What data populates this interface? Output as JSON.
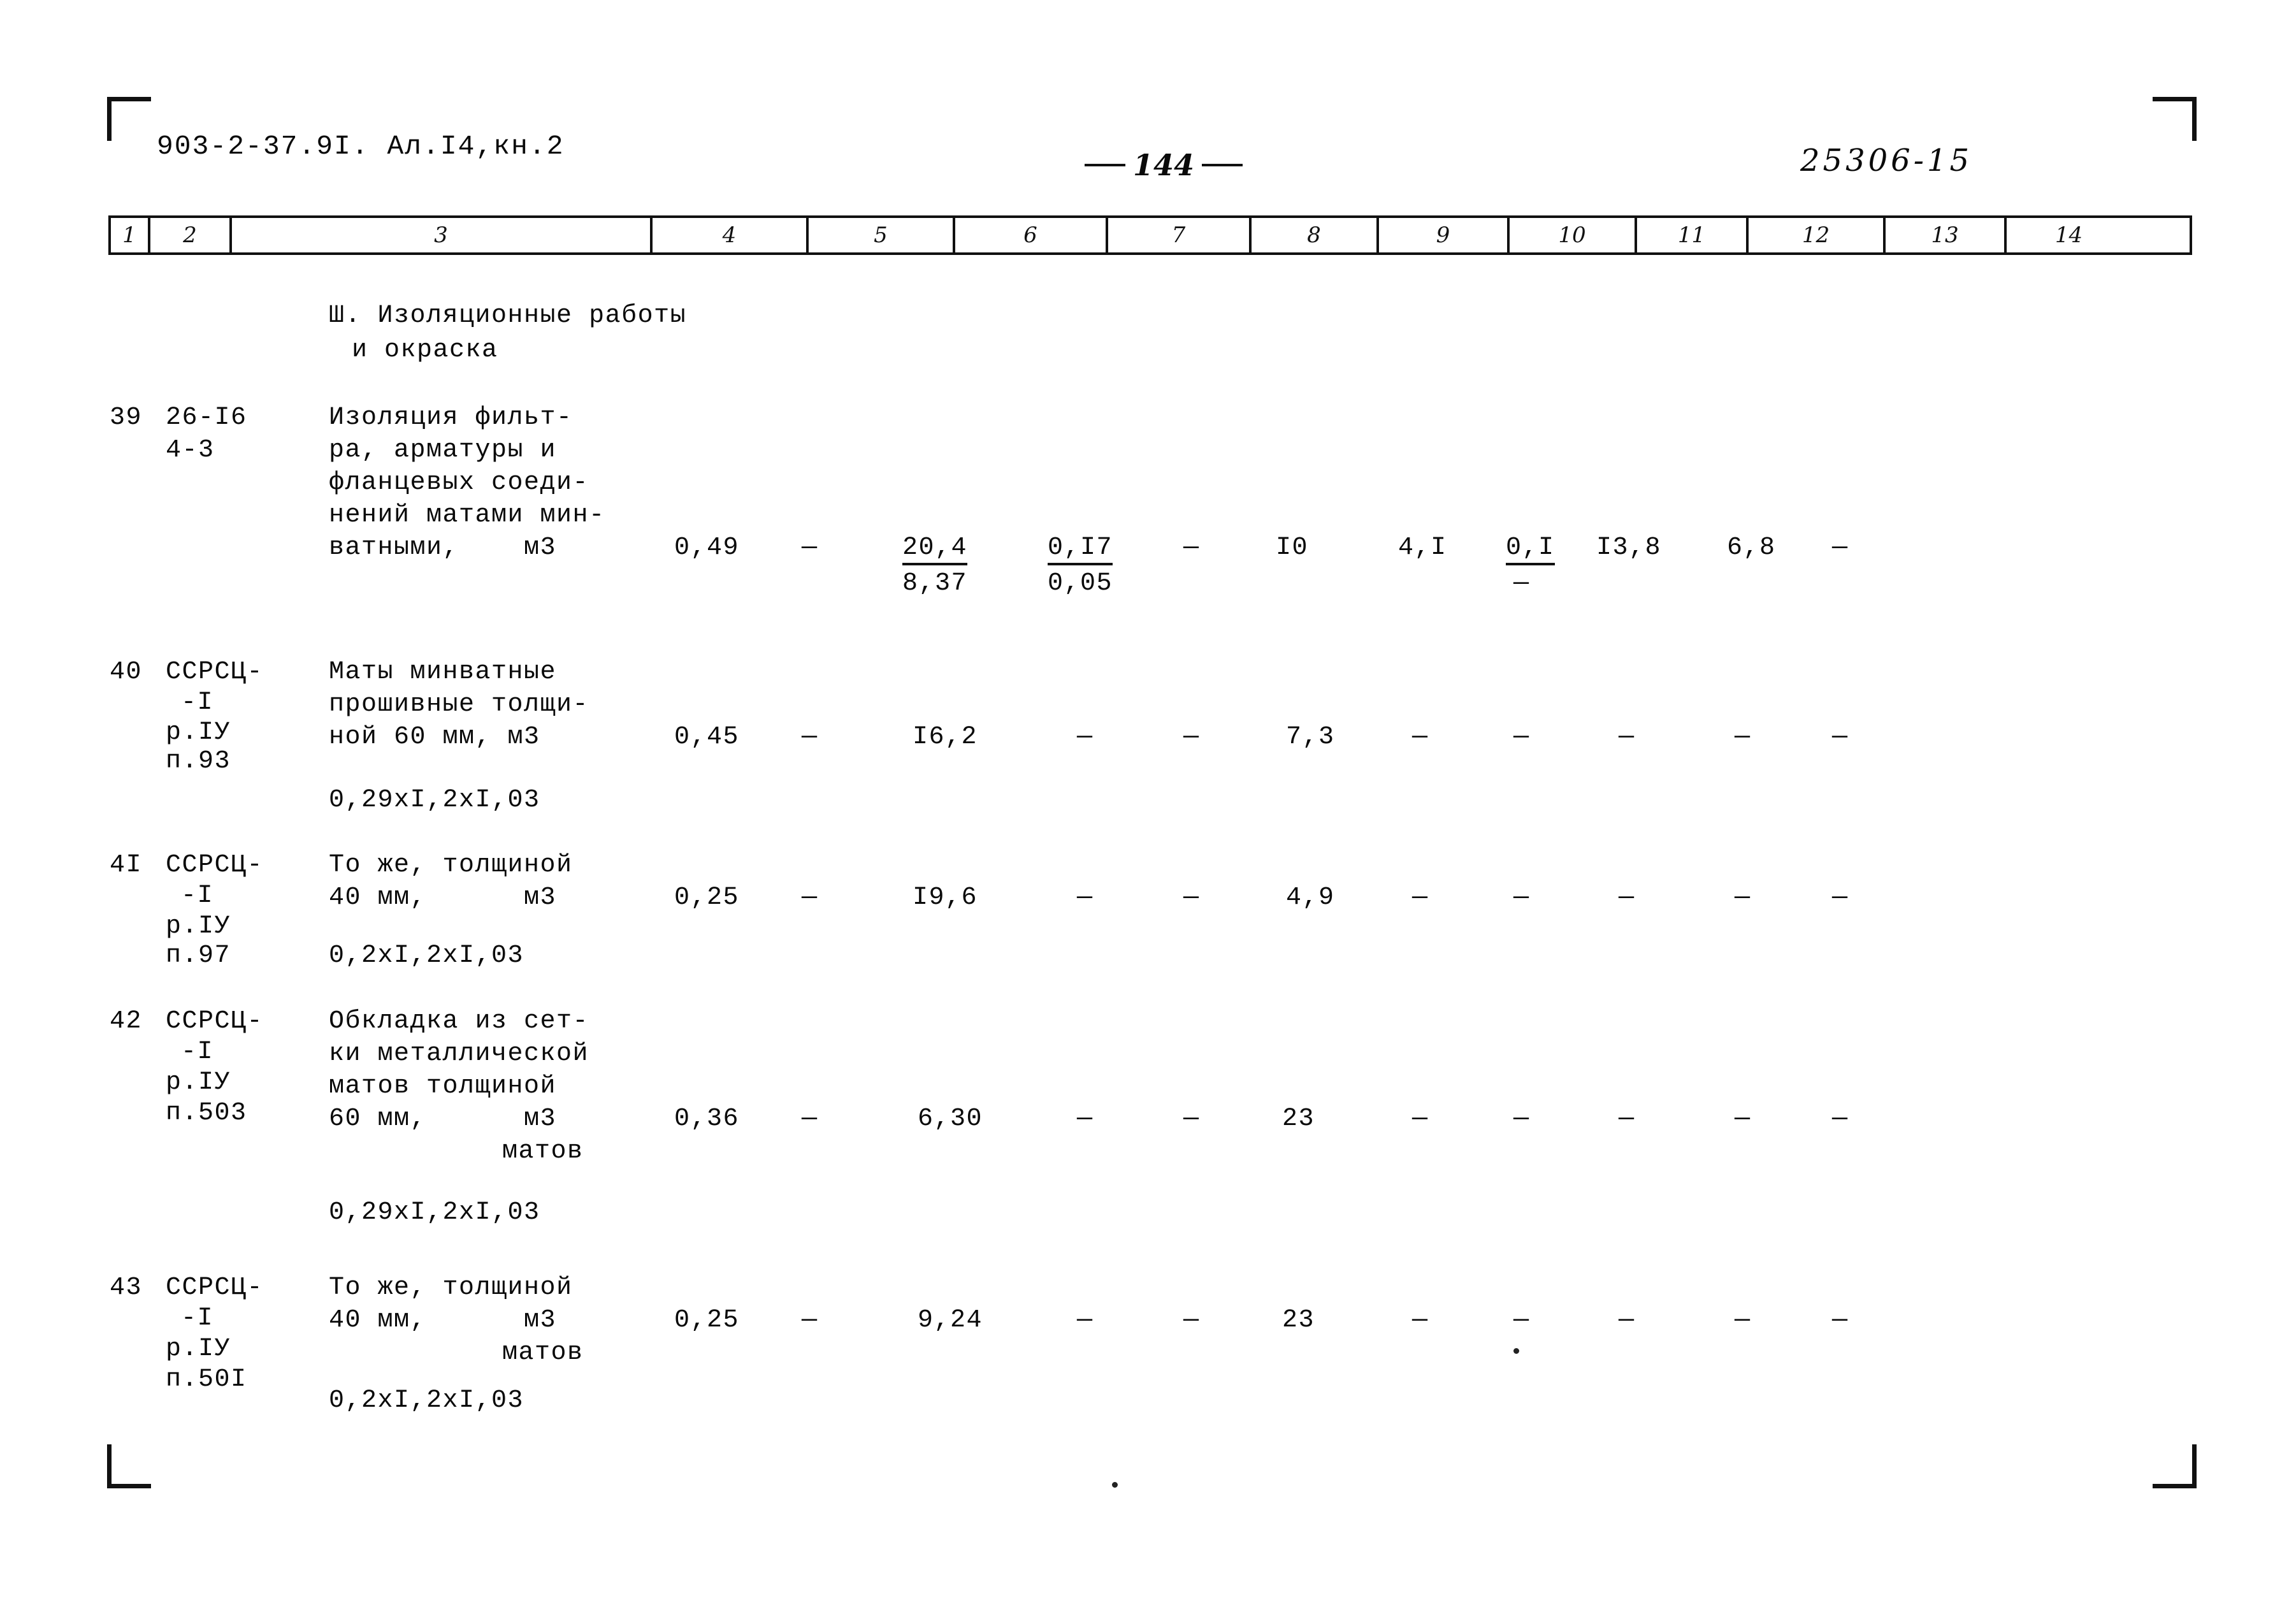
{
  "header": {
    "doc_id": "903-2-37.9I.  Ал.I4,кн.2",
    "page_number": "144",
    "archive_code": "25306-15"
  },
  "table": {
    "column_numbers": [
      "1",
      "2",
      "3",
      "4",
      "5",
      "6",
      "7",
      "8",
      "9",
      "10",
      "11",
      "12",
      "13",
      "14"
    ],
    "section_title_line1": "Ш. Изоляционные работы",
    "section_title_line2": "и окраска",
    "rows": [
      {
        "num": "39",
        "code_line1": "26-I6",
        "code_line2": "4-3",
        "desc_line1": "Изоляция фильт-",
        "desc_line2": "ра, арматуры и",
        "desc_line3": "фланцевых соеди-",
        "desc_line4": "нений матами мин-",
        "desc_line5": "ватными,    м3",
        "c4": "0,49",
        "c5": "—",
        "c6_top": "20,4",
        "c6_bot": "8,37",
        "c7_top": "0,I7",
        "c7_bot": "0,05",
        "c8": "—",
        "c9": "I0",
        "c10": "4,I",
        "c11_top": "0,I",
        "c11_bot": "—",
        "c12": "I3,8",
        "c13": "6,8",
        "c14": "—"
      },
      {
        "num": "40",
        "code_line1": "ССРСЦ-",
        "code_line2": "-I",
        "code_line3": "р.IУ",
        "code_line4": "п.93",
        "desc_line1": "Маты минватные",
        "desc_line2": "прошивные толщи-",
        "desc_line3": "ной 60 мм, м3",
        "dimensions": "0,29xI,2xI,03",
        "c4": "0,45",
        "c5": "—",
        "c6": "I6,2",
        "c7": "—",
        "c8": "—",
        "c9": "7,3",
        "c10": "—",
        "c11": "—",
        "c12": "—",
        "c13": "—",
        "c14": "—"
      },
      {
        "num": "4I",
        "code_line1": "ССРСЦ-",
        "code_line2": "-I",
        "code_line3": "р.IУ",
        "code_line4": "п.97",
        "desc_line1": "То же, толщиной",
        "desc_line2": "40 мм,      м3",
        "dimensions": "0,2xI,2xI,03",
        "c4": "0,25",
        "c5": "—",
        "c6": "I9,6",
        "c7": "—",
        "c8": "—",
        "c9": "4,9",
        "c10": "—",
        "c11": "—",
        "c12": "—",
        "c13": "—",
        "c14": "—"
      },
      {
        "num": "42",
        "code_line1": "ССРСЦ-",
        "code_line2": "-I",
        "code_line3": "р.IУ",
        "code_line4": "п.503",
        "desc_line1": "Обкладка из сет-",
        "desc_line2": "ки металлической",
        "desc_line3": "матов толщиной",
        "desc_line4": "60 мм,      м3",
        "desc_line5": "матов",
        "dimensions": "0,29xI,2xI,03",
        "c4": "0,36",
        "c5": "—",
        "c6": "6,30",
        "c7": "—",
        "c8": "—",
        "c9": "23",
        "c10": "—",
        "c11": "—",
        "c12": "—",
        "c13": "—",
        "c14": "—"
      },
      {
        "num": "43",
        "code_line1": "ССРСЦ-",
        "code_line2": "-I",
        "code_line3": "р.IУ",
        "code_line4": "п.50I",
        "desc_line1": "То же, толщиной",
        "desc_line2": "40 мм,      м3",
        "desc_line3": "матов",
        "dimensions": "0,2xI,2xI,03",
        "c4": "0,25",
        "c5": "—",
        "c6": "9,24",
        "c7": "—",
        "c8": "—",
        "c9": "23",
        "c10": "—",
        "c11": "—",
        "c12": "—",
        "c13": "—",
        "c14": "—"
      }
    ]
  }
}
